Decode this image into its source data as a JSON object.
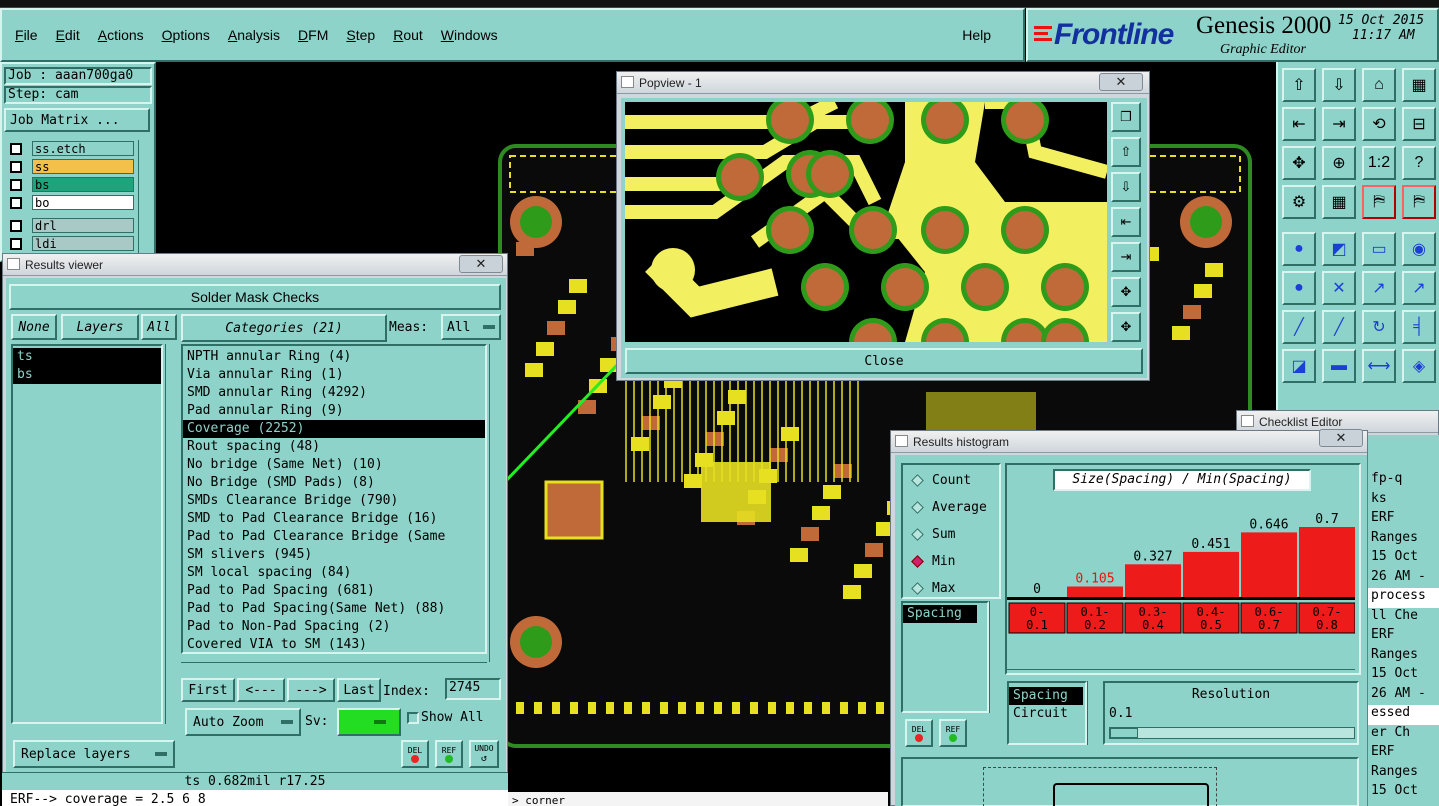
{
  "menubar": {
    "items": [
      "File",
      "Edit",
      "Actions",
      "Options",
      "Analysis",
      "DFM",
      "Step",
      "Rout",
      "Windows"
    ],
    "help": "Help"
  },
  "brand": {
    "logo": "Frontline",
    "product": "Genesis 2000",
    "subtitle": "Graphic Editor",
    "date": "15 Oct 2015",
    "time": "11:17 AM"
  },
  "job_panel": {
    "job": "Job : aaan700ga0",
    "step": "Step: cam",
    "job_matrix": "Job Matrix ...",
    "layers": [
      {
        "name": "ss.etch",
        "color": "#8ed3c9"
      },
      {
        "name": "ss",
        "color": "#f4c04a"
      },
      {
        "name": "bs",
        "color": "#1fa37a"
      },
      {
        "name": "bo",
        "color": "#ffffff"
      },
      {
        "name": "drl",
        "color": "#a9c9c6"
      },
      {
        "name": "ldi",
        "color": "#a9c9c6"
      }
    ]
  },
  "results_viewer": {
    "title": "Results viewer",
    "close": "✕",
    "header": "Solder Mask Checks",
    "none_btn": "None",
    "layers_btn": "Layers",
    "all_btn": "All",
    "layer_list": [
      "ts",
      "bs"
    ],
    "categories_btn": "Categories (21)",
    "meas_label": "Meas:",
    "meas_value": "All",
    "categories": [
      "NPTH annular Ring (4)",
      "Via annular Ring (1)",
      "SMD annular Ring (4292)",
      "Pad annular Ring (9)",
      "Coverage (2252)",
      "Rout spacing (48)",
      "No bridge (Same Net) (10)",
      "No Bridge (SMD Pads) (8)",
      "SMDs Clearance Bridge (790)",
      "SMD to Pad Clearance Bridge (16)",
      "Pad to Pad Clearance Bridge (Same",
      "SM slivers (945)",
      "SM local spacing (84)",
      "Pad to Pad Spacing (681)",
      "Pad to Pad Spacing(Same Net) (88)",
      "Pad to Non-Pad Spacing (2)",
      "Covered VIA to SM (143)"
    ],
    "selected_index": 4,
    "first": "First",
    "prev": "<---",
    "next": "--->",
    "last": "Last",
    "index_label": "Index:",
    "index_value": "2745",
    "auto_zoom": "Auto Zoom",
    "sv_label": "Sv:",
    "show_all": "Show All",
    "replace_layers": "Replace layers",
    "del": "DEL",
    "ref": "REF",
    "undo": "UNDO"
  },
  "status": {
    "line1": "ts 0.682mil  r17.25",
    "line2": "ERF--> coverage = 2.5 6 8",
    "line3": "> corner"
  },
  "popview": {
    "title": "Popview - 1",
    "close_label": "Close"
  },
  "histogram": {
    "title": "Results histogram",
    "options": [
      "Count",
      "Average",
      "Sum",
      "Min",
      "Max"
    ],
    "selected_option": "Min",
    "chart_title": "Size(Spacing) / Min(Spacing)",
    "list": [
      "Spacing"
    ],
    "list2": [
      "Spacing",
      "Circuit"
    ],
    "resolution_label": "Resolution",
    "resolution_value": "0.1",
    "del": "DEL",
    "ref": "REF"
  },
  "chart_data": {
    "type": "bar",
    "title": "Size(Spacing) / Min(Spacing)",
    "categories": [
      "0-0.1",
      "0.1-0.2",
      "0.3-0.4",
      "0.4-0.5",
      "0.6-0.7",
      "0.7-0.8"
    ],
    "category_labels": [
      [
        "0-",
        "0.1"
      ],
      [
        "0.1-",
        "0.2"
      ],
      [
        "0.3-",
        "0.4"
      ],
      [
        "0.4-",
        "0.5"
      ],
      [
        "0.6-",
        "0.7"
      ],
      [
        "0.7-",
        "0.8"
      ]
    ],
    "values": [
      0,
      0.105,
      0.327,
      0.451,
      0.646,
      0.7
    ],
    "value_labels": [
      "0",
      "0.105",
      "0.327",
      "0.451",
      "0.646",
      "0.7"
    ],
    "ylim": [
      0,
      0.7
    ],
    "bar_color": "#ee1b1b"
  },
  "checklist": {
    "title": "Checklist Editor",
    "close": "✕",
    "rows": [
      "fp-q",
      "ks",
      "ERF",
      "Ranges",
      "15 Oct",
      "26 AM -",
      "process",
      "ll Che",
      "ERF",
      "Ranges",
      "15 Oct",
      "26 AM -",
      "essed",
      "er Ch",
      "ERF",
      "Ranges",
      "15 Oct"
    ]
  }
}
